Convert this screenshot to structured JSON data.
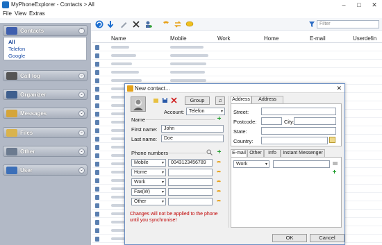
{
  "window": {
    "title": "MyPhoneExplorer - Contacts > All",
    "minimize": "–",
    "maximize": "□",
    "close": "✕"
  },
  "menu": [
    "File",
    "View",
    "Extras"
  ],
  "toolbar": {
    "filter_placeholder": "Filter"
  },
  "sidebar": {
    "sections": [
      {
        "label": "Contacts",
        "icon": "contacts-icon",
        "color": "#3f5fae"
      },
      {
        "label": "Call log",
        "icon": "phone-icon",
        "color": "#555555"
      },
      {
        "label": "Organizer",
        "icon": "organizer-icon",
        "color": "#3f5f8e"
      },
      {
        "label": "Messages",
        "icon": "messages-icon",
        "color": "#d5a53a"
      },
      {
        "label": "Files",
        "icon": "folder-icon",
        "color": "#d9b34d"
      },
      {
        "label": "Other",
        "icon": "tools-icon",
        "color": "#6b7a8f"
      },
      {
        "label": "User",
        "icon": "user-icon",
        "color": "#3c6fb8"
      }
    ],
    "contacts_items": [
      "All",
      "Telefon",
      "Google"
    ]
  },
  "list": {
    "columns": [
      "Name",
      "Mobile",
      "Work",
      "Home",
      "E-mail",
      "Userdefin"
    ]
  },
  "dialog": {
    "title": "New contact...",
    "group_button": "Group",
    "note_button": "♫",
    "account_label": "Account:",
    "account_value": "Telefon",
    "name_section": "Name",
    "first_name_label": "First name:",
    "first_name_value": "John",
    "last_name_label": "Last name:",
    "last_name_value": "Doe",
    "phone_section": "Phone numbers",
    "phones": [
      {
        "type": "Mobile",
        "value": "0043123456789"
      },
      {
        "type": "Home",
        "value": ""
      },
      {
        "type": "Work",
        "value": ""
      },
      {
        "type": "Fax(W)",
        "value": ""
      },
      {
        "type": "Other",
        "value": ""
      }
    ],
    "warning": "Changes will not be applied to the phone until you synchronise!",
    "address_tabs": [
      "Address",
      "Address (work)"
    ],
    "street_label": "Street:",
    "postcode_label": "Postcode:",
    "city_label": "City:",
    "state_label": "State:",
    "country_label": "Country:",
    "bottom_tabs": [
      "E-mail",
      "Other",
      "Info",
      "Instant Messenger"
    ],
    "email_type": "Work",
    "ok_button": "OK",
    "cancel_button": "Cancel",
    "warning_color": "#c00000"
  }
}
